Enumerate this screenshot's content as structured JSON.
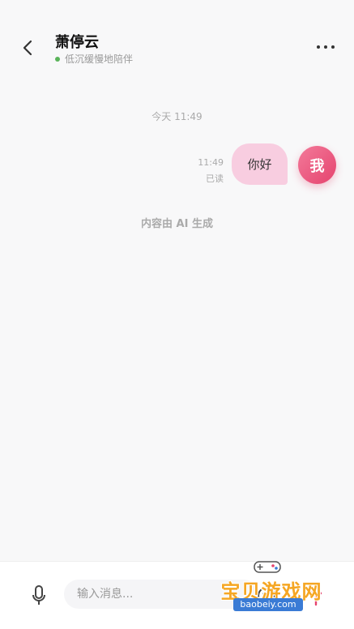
{
  "header": {
    "title": "萧停云",
    "status": "低沉缓慢地陪伴",
    "status_color": "#5ab45a"
  },
  "chat": {
    "time_divider": "今天 11:49",
    "messages": [
      {
        "sender": "user",
        "text": "你好",
        "time": "11:49",
        "read_status": "已读",
        "avatar_label": "我",
        "bubble_color": "#f8cde0"
      }
    ],
    "ai_note": "内容由 AI 生成"
  },
  "input_bar": {
    "placeholder": "输入消息..."
  },
  "watermark": {
    "text": "宝贝游戏网",
    "url": "baobeiy.com"
  },
  "icons": [
    "back-arrow-icon",
    "more-dots-icon",
    "microphone-icon",
    "emoji-icon",
    "send-icon",
    "game-controller-icon"
  ],
  "colors": {
    "accent": "#e5436e",
    "bubble": "#f8cde0",
    "online": "#5ab45a"
  }
}
